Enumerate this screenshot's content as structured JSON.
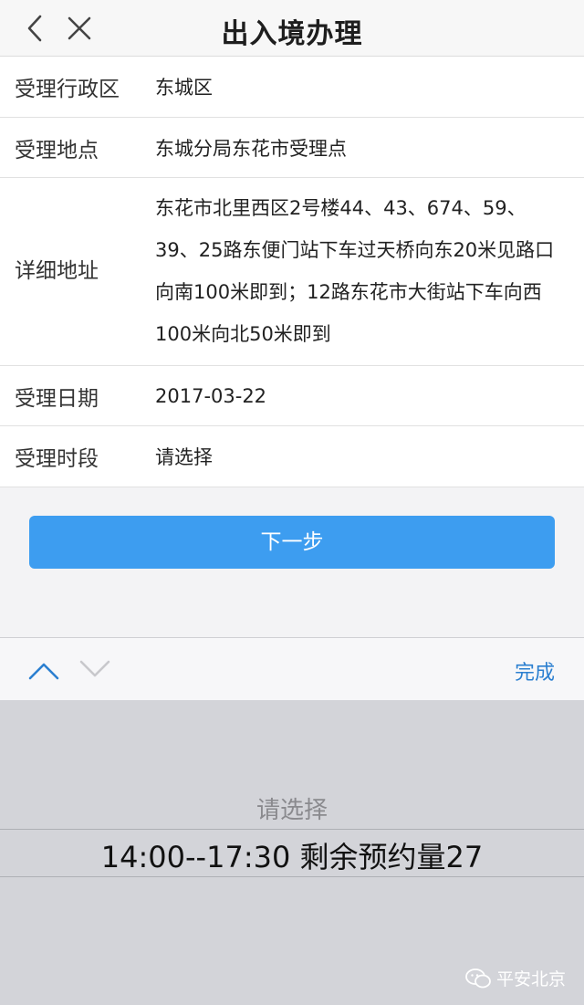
{
  "nav": {
    "title": "出入境办理",
    "back_icon": "chevron-left-icon",
    "close_icon": "close-icon"
  },
  "form": {
    "rows": [
      {
        "label": "受理行政区",
        "value": "东城区"
      },
      {
        "label": "受理地点",
        "value": "东城分局东花市受理点"
      },
      {
        "label": "详细地址",
        "value": "东花市北里西区2号楼44、43、674、59、39、25路东便门站下车过天桥向东20米见路口向南100米即到；12路东花市大街站下车向西100米向北50米即到"
      },
      {
        "label": "受理日期",
        "value": "2017-03-22"
      },
      {
        "label": "受理时段",
        "value": "请选择"
      }
    ]
  },
  "next_button": {
    "label": "下一步"
  },
  "toolbar": {
    "up_icon": "chevron-up-icon",
    "down_icon": "chevron-down-icon",
    "done_label": "完成"
  },
  "picker": {
    "options": [
      "请选择",
      "14:00--17:30 剩余预约量27"
    ],
    "selected_index": 1
  },
  "watermark": {
    "text": "平安北京"
  },
  "colors": {
    "accent": "#3d9df0",
    "link": "#2b7fd0",
    "picker_bg": "#d3d4d9"
  }
}
